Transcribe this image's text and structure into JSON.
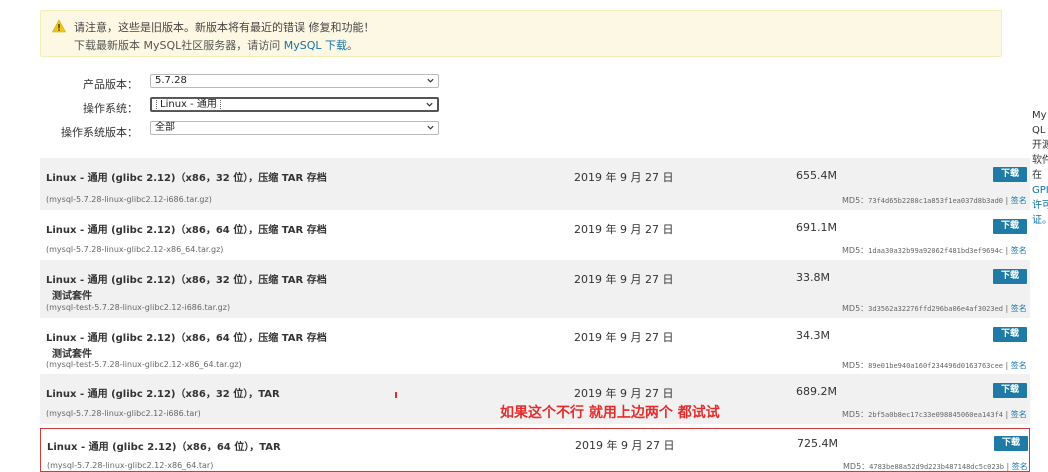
{
  "notice": {
    "line1": "请注意，这些是旧版本。新版本将有最近的错误 修复和功能！",
    "line2_prefix": "下载最新版本 MySQL社区服务器，请访问 ",
    "line2_link": "MySQL 下载",
    "line2_suffix": "。"
  },
  "filters": [
    {
      "label": "产品版本：",
      "value": "5.7.28"
    },
    {
      "label": "操作系统：",
      "value": "Linux - 通用"
    },
    {
      "label": "操作系统版本：",
      "value": "全部"
    }
  ],
  "rows": [
    {
      "title": "Linux - 通用 (glibc 2.12)（x86，32 位），压缩 TAR 存档",
      "subtitle": "",
      "file": "(mysql-5.7.28-linux-glibc2.12-i686.tar.gz)",
      "date": "2019 年 9 月 27 日",
      "size": "655.4M",
      "download": "下载",
      "md5_label": "MD5：",
      "md5": "73f4d65b2288c1a853f1ea037d8b3ad0",
      "sig_sep": " | ",
      "signature": "签名"
    },
    {
      "title": "Linux - 通用 (glibc 2.12)（x86，64 位），压缩 TAR 存档",
      "subtitle": "",
      "file": "(mysql-5.7.28-linux-glibc2.12-x86_64.tar.gz)",
      "date": "2019 年 9 月 27 日",
      "size": "691.1M",
      "download": "下载",
      "md5_label": "MD5：",
      "md5": "1daa30a32b99a92062f481bd3ef9694c",
      "sig_sep": " | ",
      "signature": "签名"
    },
    {
      "title": "Linux - 通用 (glibc 2.12)（x86，32 位），压缩 TAR 存档",
      "subtitle": "测试套件",
      "file": "(mysql-test-5.7.28-linux-glibc2.12-i686.tar.gz)",
      "date": "2019 年 9 月 27 日",
      "size": "33.8M",
      "download": "下载",
      "md5_label": "MD5：",
      "md5": "3d3562a32276ffd296ba06e4af3023ed",
      "sig_sep": " | ",
      "signature": "签名"
    },
    {
      "title": "Linux - 通用 (glibc 2.12)（x86，64 位），压缩 TAR 存档",
      "subtitle": "测试套件",
      "file": "(mysql-test-5.7.28-linux-glibc2.12-x86_64.tar.gz)",
      "date": "2019 年 9 月 27 日",
      "size": "34.3M",
      "download": "下载",
      "md5_label": "MD5：",
      "md5": "89e01be940a160f234496d0163763cee",
      "sig_sep": " | ",
      "signature": "签名"
    },
    {
      "title": "Linux - 通用 (glibc 2.12)（x86，32 位），TAR",
      "subtitle": "",
      "file": "(mysql-5.7.28-linux-glibc2.12-i686.tar)",
      "date": "2019 年 9 月 27 日",
      "size": "689.2M",
      "download": "下载",
      "md5_label": "MD5：",
      "md5": "2bf5a0b8ec17c33e098845060ea143f4",
      "sig_sep": " | ",
      "signature": "签名"
    },
    {
      "title": "Linux - 通用 (glibc 2.12)（x86，64 位），TAR",
      "subtitle": "",
      "file": "(mysql-5.7.28-linux-glibc2.12-x86_64.tar)",
      "date": "2019 年 9 月 27 日",
      "size": "725.4M",
      "download": "下载",
      "md5_label": "MD5：",
      "md5": "4783be88a52d9d223b487148dc5c023b",
      "sig_sep": " | ",
      "signature": "签名"
    }
  ],
  "annotation": "如果这个不行 就用上边两个 都试试",
  "sidebar": {
    "lines": [
      "My",
      "QL",
      "开源",
      "软件",
      "在"
    ],
    "link_lines": [
      "GPI",
      "许可",
      "证。"
    ]
  },
  "colors": {
    "download_button": "#1f7ba6",
    "link": "#0f74a8",
    "annotation": "#e52c2c",
    "notice_bg": "#fcf8e3"
  }
}
